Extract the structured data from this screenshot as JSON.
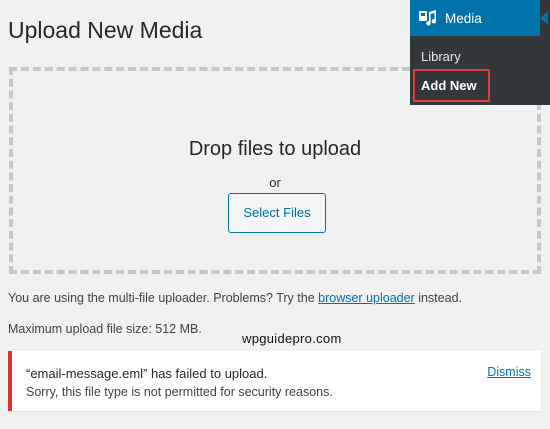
{
  "page": {
    "title": "Upload New Media"
  },
  "drop_zone": {
    "title": "Drop files to upload",
    "or_text": "or",
    "select_button": "Select Files"
  },
  "uploader_info": {
    "prefix": "You are using the multi-file uploader. Problems? Try the ",
    "link": "browser uploader",
    "suffix": " instead."
  },
  "max_size": "Maximum upload file size: 512 MB.",
  "watermark": "wpguidepro.com",
  "notice": {
    "title": "“email-message.eml” has failed to upload.",
    "message": "Sorry, this file type is not permitted for security reasons.",
    "dismiss": "Dismiss",
    "accent_color": "#dc3232"
  },
  "admin_menu": {
    "head_label": "Media",
    "head_icon": "media-icon",
    "items": [
      {
        "label": "Library"
      },
      {
        "label": "Add New"
      }
    ],
    "head_color": "#0073aa",
    "background_color": "#32373c",
    "highlight_color": "#e53935"
  }
}
